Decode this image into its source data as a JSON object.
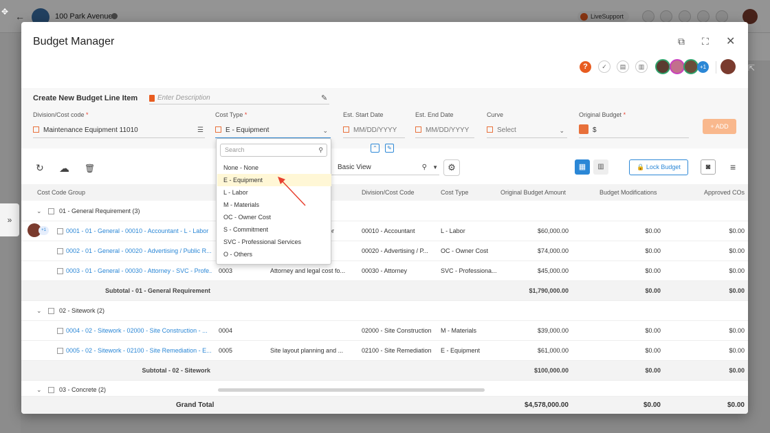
{
  "app": {
    "project_name": "100 Park Avenue",
    "livesupport_label": "LiveSupport"
  },
  "modal": {
    "title": "Budget Manager",
    "avatar_extra_count": "+1"
  },
  "form": {
    "create_label": "Create New Budget Line Item",
    "description_placeholder": "Enter Description",
    "division_label": "Division/Cost code",
    "division_value": "Maintenance Equipment 11010",
    "cost_type_label": "Cost Type",
    "cost_type_value": "E - Equipment",
    "start_date_label": "Est. Start Date",
    "start_date_placeholder": "MM/DD/YYYY",
    "end_date_label": "Est. End Date",
    "end_date_placeholder": "MM/DD/YYYY",
    "curve_label": "Curve",
    "curve_placeholder": "Select",
    "original_budget_label": "Original Budget",
    "original_budget_value": "$",
    "add_button": "+ ADD",
    "required_mark": "*"
  },
  "toolbar": {
    "view_value": "Basic View",
    "lock_budget_label": "Lock Budget"
  },
  "dropdown": {
    "search_placeholder": "Search",
    "items": [
      "None - None",
      "E - Equipment",
      "L - Labor",
      "M - Materials",
      "OC - Owner Cost",
      "S - Commitment",
      "SVC - Professional Services",
      "O - Others"
    ],
    "selected_index": 1
  },
  "table": {
    "columns": {
      "cost_code_group": "Cost Code Group",
      "division_cost_code": "Division/Cost Code",
      "cost_type": "Cost Type",
      "original_budget_amount": "Original Budget Amount",
      "budget_modifications": "Budget Modifications",
      "approved_cos": "Approved COs"
    },
    "rows": [
      {
        "kind": "group",
        "label": "01 - General Requirement (3)"
      },
      {
        "kind": "item",
        "label": "0001 - 01 - General - 00010 - Accountant - L - Labor",
        "code": "",
        "desc": "nt labor",
        "division": "00010 - Accountant",
        "cost_type": "L - Labor",
        "original": "$60,000.00",
        "mods": "$0.00",
        "cos": "$0.00"
      },
      {
        "kind": "item",
        "label": "0002 - 01 - General - 00020 - Advertising / Public R...",
        "code": "",
        "desc": "",
        "division": "00020 - Advertising / P...",
        "cost_type": "OC - Owner Cost",
        "original": "$74,000.00",
        "mods": "$0.00",
        "cos": "$0.00"
      },
      {
        "kind": "item",
        "label": "0003 - 01 - General - 00030 - Attorney - SVC - Profe...",
        "code": "0003",
        "desc": "Attorney and legal cost fo...",
        "division": "00030 - Attorney",
        "cost_type": "SVC - Professiona...",
        "original": "$45,000.00",
        "mods": "$0.00",
        "cos": "$0.00"
      },
      {
        "kind": "subtotal",
        "label": "Subtotal - 01 - General Requirement",
        "original": "$1,790,000.00",
        "mods": "$0.00",
        "cos": "$0.00"
      },
      {
        "kind": "group",
        "label": "02 - Sitework (2)"
      },
      {
        "kind": "item",
        "label": "0004 - 02 - Sitework - 02000 - Site Construction - ...",
        "code": "0004",
        "desc": "",
        "division": "02000 - Site Construction",
        "cost_type": "M - Materials",
        "original": "$39,000.00",
        "mods": "$0.00",
        "cos": "$0.00"
      },
      {
        "kind": "item",
        "label": "0005 - 02 - Sitework - 02100 - Site Remediation - E...",
        "code": "0005",
        "desc": "Site layout planning and ...",
        "division": "02100 - Site Remediation",
        "cost_type": "E - Equipment",
        "original": "$61,000.00",
        "mods": "$0.00",
        "cos": "$0.00"
      },
      {
        "kind": "subtotal",
        "label": "Subtotal - 02 - Sitework",
        "original": "$100,000.00",
        "mods": "$0.00",
        "cos": "$0.00"
      },
      {
        "kind": "group",
        "label": "03 - Concrete (2)"
      }
    ],
    "grand_total": {
      "label": "Grand Total",
      "original": "$4,578,000.00",
      "mods": "$0.00",
      "cos": "$0.00"
    }
  },
  "colors": {
    "accent_blue": "#2b87d6",
    "accent_orange": "#e85c20",
    "selected_item_bg": "#fff7d6",
    "arrow_red": "#e8402f"
  }
}
